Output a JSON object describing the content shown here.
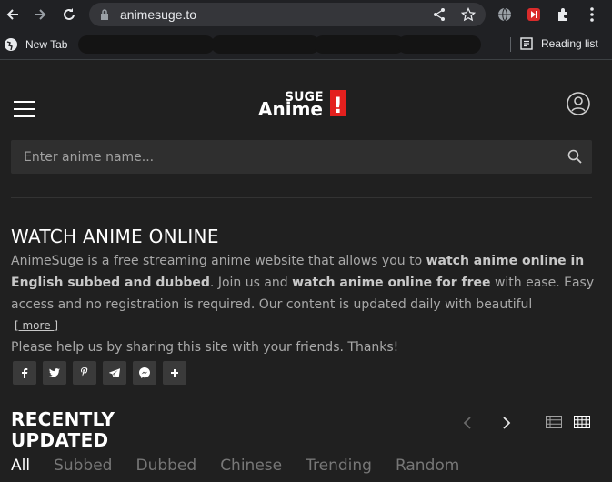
{
  "browser": {
    "url": "animesuge.to",
    "bookmarks": {
      "new_tab": "New Tab",
      "reading_list": "Reading list"
    },
    "icons": [
      "back-arrow-icon",
      "forward-arrow-icon",
      "reload-icon",
      "lock-icon",
      "share-icon",
      "star-icon",
      "globe-icon",
      "extension-red-icon",
      "puzzle-icon",
      "kebab-menu-icon",
      "reading-list-icon"
    ]
  },
  "site": {
    "logo": {
      "top": "SUGE",
      "main": "Anime",
      "bang": "!"
    },
    "search": {
      "placeholder": "Enter anime name..."
    },
    "watch": {
      "title": "WATCH ANIME ONLINE",
      "p1": "AnimeSuge is a free streaming anime website that allows you to ",
      "b1": "watch anime online in English subbed and dubbed",
      "p2": ". Join us and ",
      "b2": "watch anime online for free",
      "p3": " with ease. Easy access and no registration is required. Our content is updated daily with beautiful layouts,...",
      "more": "[ more ]",
      "share": "Please help us by sharing this site with your friends. Thanks!"
    },
    "social": [
      "facebook-icon",
      "twitter-icon",
      "pinterest-icon",
      "telegram-icon",
      "messenger-icon",
      "plus-icon"
    ],
    "recent": {
      "title": "RECENTLY UPDATED",
      "tabs": [
        "All",
        "Subbed",
        "Dubbed",
        "Chinese",
        "Trending",
        "Random"
      ],
      "active_tab": "All"
    },
    "colors": {
      "accent": "#e3201e",
      "bg": "#202020",
      "search_bg": "#2f2f2f"
    }
  }
}
